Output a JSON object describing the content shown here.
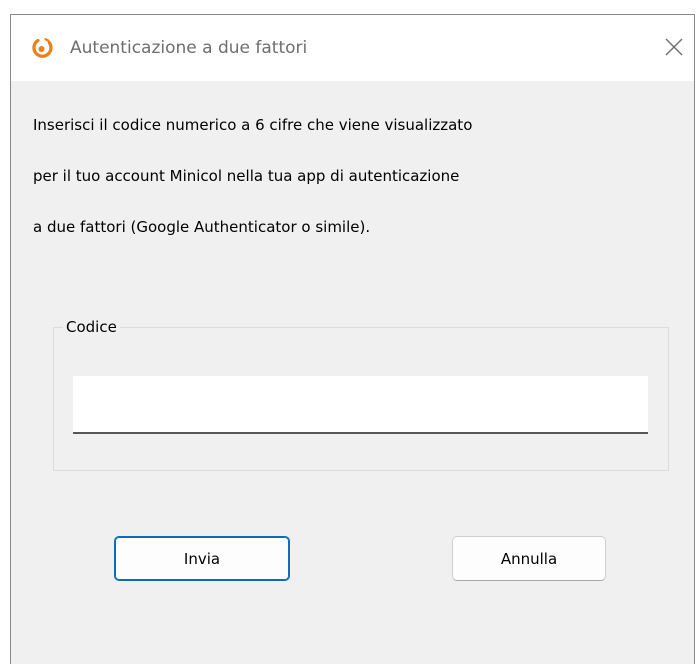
{
  "window": {
    "title": "Autenticazione a due fattori",
    "icon": "minicol-logo-icon",
    "close_icon": "close-icon",
    "accent_color": "#e8811a"
  },
  "content": {
    "instructions": [
      "Inserisci il codice numerico a 6 cifre che viene visualizzato",
      "per il tuo account Minicol nella tua app di autenticazione",
      "a due fattori (Google Authenticator o simile)."
    ],
    "code_group": {
      "label": "Codice",
      "value": "",
      "placeholder": ""
    }
  },
  "buttons": {
    "send_label": "Invia",
    "cancel_label": "Annulla",
    "focus_color": "#0f6cbd"
  }
}
